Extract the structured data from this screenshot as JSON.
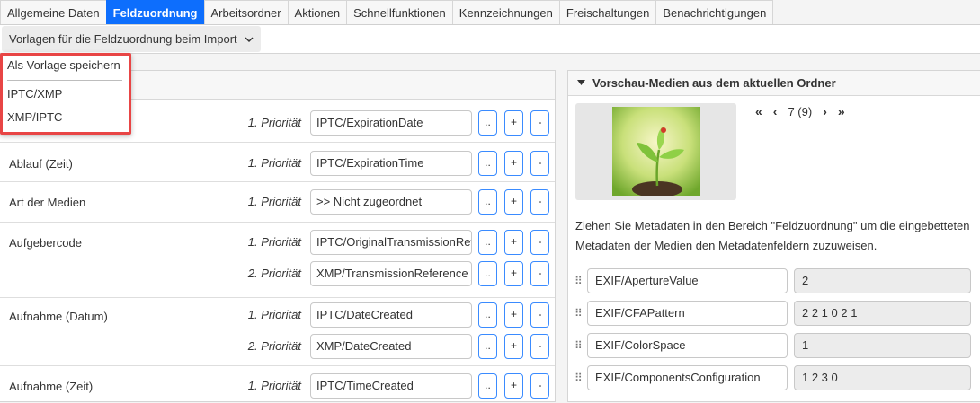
{
  "tabs": [
    {
      "label": "Allgemeine Daten",
      "active": false
    },
    {
      "label": "Feldzuordnung",
      "active": true
    },
    {
      "label": "Arbeitsordner",
      "active": false
    },
    {
      "label": "Aktionen",
      "active": false
    },
    {
      "label": "Schnellfunktionen",
      "active": false
    },
    {
      "label": "Kennzeichnungen",
      "active": false
    },
    {
      "label": "Freischaltungen",
      "active": false
    },
    {
      "label": "Benachrichtigungen",
      "active": false
    }
  ],
  "toolbar": {
    "templates_label": "Vorlagen für die Feldzuordnung beim Import"
  },
  "dropdown": {
    "items": [
      "Als Vorlage speichern",
      "IPTC/XMP",
      "XMP/IPTC"
    ]
  },
  "fields": [
    {
      "name": "",
      "priorities": [
        {
          "label": "1. Priorität",
          "value": "IPTC/ExpirationDate"
        }
      ]
    },
    {
      "name": "Ablauf (Zeit)",
      "priorities": [
        {
          "label": "1. Priorität",
          "value": "IPTC/ExpirationTime"
        }
      ]
    },
    {
      "name": "Art der Medien",
      "priorities": [
        {
          "label": "1. Priorität",
          "value": ">> Nicht zugeordnet"
        }
      ]
    },
    {
      "name": "Aufgebercode",
      "priorities": [
        {
          "label": "1. Priorität",
          "value": "IPTC/OriginalTransmissionReference"
        },
        {
          "label": "2. Priorität",
          "value": "XMP/TransmissionReference"
        }
      ]
    },
    {
      "name": "Aufnahme (Datum)",
      "priorities": [
        {
          "label": "1. Priorität",
          "value": "IPTC/DateCreated"
        },
        {
          "label": "2. Priorität",
          "value": "XMP/DateCreated"
        }
      ]
    },
    {
      "name": "Aufnahme (Zeit)",
      "priorities": [
        {
          "label": "1. Priorität",
          "value": "IPTC/TimeCreated"
        }
      ]
    }
  ],
  "buttons": {
    "browse": "..",
    "add": "+",
    "remove": "-"
  },
  "preview": {
    "title": "Vorschau-Medien aus dem aktuellen Ordner",
    "pager_text": "7 (9)",
    "hint": "Ziehen Sie Metadaten in den Bereich \"Feldzuordnung\" um die eingebetteten Metadaten der Medien den Metadatenfeldern zuzuweisen.",
    "metadata": [
      {
        "key": "EXIF/ApertureValue",
        "value": "2"
      },
      {
        "key": "EXIF/CFAPattern",
        "value": "2 2 1 0 2 1"
      },
      {
        "key": "EXIF/ColorSpace",
        "value": "1"
      },
      {
        "key": "EXIF/ComponentsConfiguration",
        "value": "1 2 3 0"
      }
    ]
  },
  "colors": {
    "accent": "#0d6efd",
    "highlight": "#e84545"
  }
}
